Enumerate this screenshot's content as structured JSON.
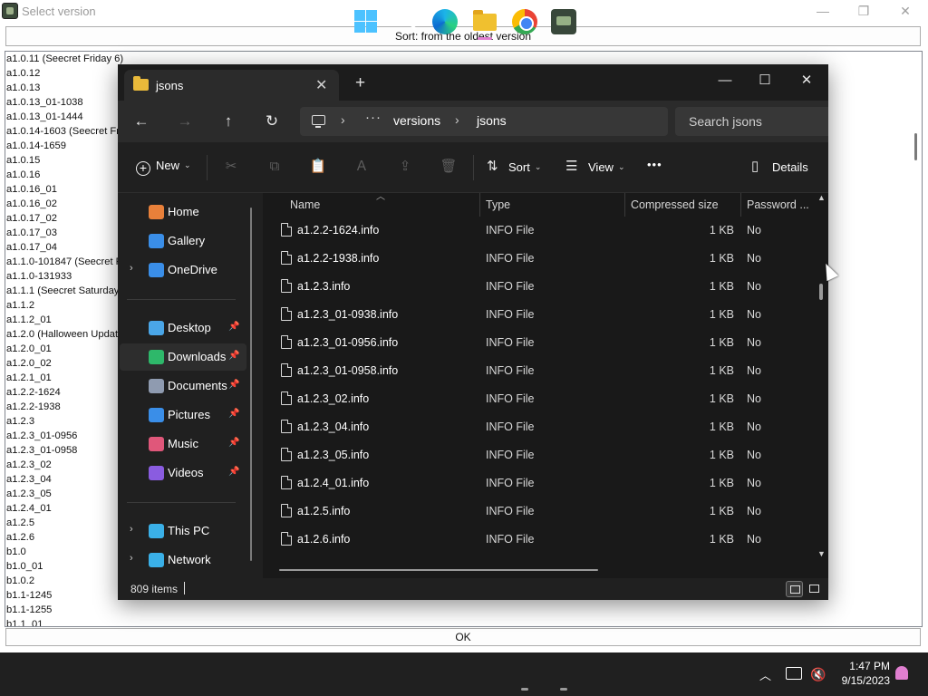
{
  "bg_window": {
    "title": "Select version",
    "controls": {
      "minimize": "—",
      "maximize": "❐",
      "close": "✕"
    },
    "sort_button": "Sort: from the oldest version",
    "ok_button": "OK",
    "versions": [
      "a1.0.11 (Seecret Friday 6)",
      "a1.0.12",
      "a1.0.13",
      "a1.0.13_01-1038",
      "a1.0.13_01-1444",
      "a1.0.14-1603 (Seecret Fr",
      "a1.0.14-1659",
      "a1.0.15",
      "a1.0.16",
      "a1.0.16_01",
      "a1.0.16_02",
      "a1.0.17_02",
      "a1.0.17_03",
      "a1.0.17_04",
      "a1.1.0-101847 (Seecret F",
      "a1.1.0-131933",
      "a1.1.1 (Seecret Saturday",
      "a1.1.2",
      "a1.1.2_01",
      "a1.2.0 (Halloween Update",
      "a1.2.0_01",
      "a1.2.0_02",
      "a1.2.1_01",
      "a1.2.2-1624",
      "a1.2.2-1938",
      "a1.2.3",
      "a1.2.3_01-0956",
      "a1.2.3_01-0958",
      "a1.2.3_02",
      "a1.2.3_04",
      "a1.2.3_05",
      "a1.2.4_01",
      "a1.2.5",
      "a1.2.6",
      "b1.0",
      "b1.0_01",
      "b1.0.2",
      "b1.1-1245",
      "b1.1-1255",
      "b1.1_01"
    ]
  },
  "explorer": {
    "tab_title": "jsons",
    "tab_close": "✕",
    "new_tab": "+",
    "window_controls": {
      "minimize": "—",
      "maximize": "☐",
      "close": "✕"
    },
    "nav": {
      "back": "←",
      "forward": "→",
      "up": "↑",
      "refresh": "↻"
    },
    "address": {
      "dots": "···",
      "crumbs": [
        "versions",
        "jsons"
      ],
      "sep": "›"
    },
    "search_placeholder": "Search jsons",
    "commands": {
      "new": "New",
      "sort": "Sort",
      "view": "View",
      "more": "•••",
      "details": "Details",
      "cut": "✂",
      "copy": "⧉",
      "paste": "📋",
      "rename": "Ａ",
      "share": "⇪",
      "delete": "🗑",
      "sort_icon": "⇅",
      "view_icon": "☰",
      "details_icon": "▯"
    },
    "sidebar": {
      "items": [
        {
          "label": "Home",
          "icon_color": "#e8803a",
          "expandable": false,
          "pinned": false
        },
        {
          "label": "Gallery",
          "icon_color": "#3a8ee8",
          "expandable": false,
          "pinned": false
        },
        {
          "label": "OneDrive",
          "icon_color": "#3a8ee8",
          "expandable": true,
          "pinned": false
        },
        {
          "label": "Desktop",
          "icon_color": "#4aa6e8",
          "expandable": false,
          "pinned": true
        },
        {
          "label": "Downloads",
          "icon_color": "#2eb86a",
          "expandable": false,
          "pinned": true
        },
        {
          "label": "Documents",
          "icon_color": "#8f9bb0",
          "expandable": false,
          "pinned": true
        },
        {
          "label": "Pictures",
          "icon_color": "#3a8ee8",
          "expandable": false,
          "pinned": true
        },
        {
          "label": "Music",
          "icon_color": "#e0577a",
          "expandable": false,
          "pinned": true
        },
        {
          "label": "Videos",
          "icon_color": "#8a5ce0",
          "expandable": false,
          "pinned": true
        },
        {
          "label": "This PC",
          "icon_color": "#3ab0e8",
          "expandable": true,
          "pinned": false
        },
        {
          "label": "Network",
          "icon_color": "#3ab0e8",
          "expandable": true,
          "pinned": false
        }
      ],
      "expand_glyph": "›",
      "pin_glyph": "📌"
    },
    "columns": [
      "Name",
      "Type",
      "Compressed size",
      "Password ..."
    ],
    "files": [
      {
        "name": "a1.2.2-1624.info",
        "type": "INFO File",
        "size": "1 KB",
        "password": "No"
      },
      {
        "name": "a1.2.2-1938.info",
        "type": "INFO File",
        "size": "1 KB",
        "password": "No"
      },
      {
        "name": "a1.2.3.info",
        "type": "INFO File",
        "size": "1 KB",
        "password": "No"
      },
      {
        "name": "a1.2.3_01-0938.info",
        "type": "INFO File",
        "size": "1 KB",
        "password": "No"
      },
      {
        "name": "a1.2.3_01-0956.info",
        "type": "INFO File",
        "size": "1 KB",
        "password": "No"
      },
      {
        "name": "a1.2.3_01-0958.info",
        "type": "INFO File",
        "size": "1 KB",
        "password": "No"
      },
      {
        "name": "a1.2.3_02.info",
        "type": "INFO File",
        "size": "1 KB",
        "password": "No"
      },
      {
        "name": "a1.2.3_04.info",
        "type": "INFO File",
        "size": "1 KB",
        "password": "No"
      },
      {
        "name": "a1.2.3_05.info",
        "type": "INFO File",
        "size": "1 KB",
        "password": "No"
      },
      {
        "name": "a1.2.4_01.info",
        "type": "INFO File",
        "size": "1 KB",
        "password": "No"
      },
      {
        "name": "a1.2.5.info",
        "type": "INFO File",
        "size": "1 KB",
        "password": "No"
      },
      {
        "name": "a1.2.6.info",
        "type": "INFO File",
        "size": "1 KB",
        "password": "No"
      }
    ],
    "status": "809 items"
  },
  "taskbar": {
    "time": "1:47 PM",
    "date": "9/15/2023",
    "tray_chevron": "︿",
    "volume": "🔇"
  }
}
